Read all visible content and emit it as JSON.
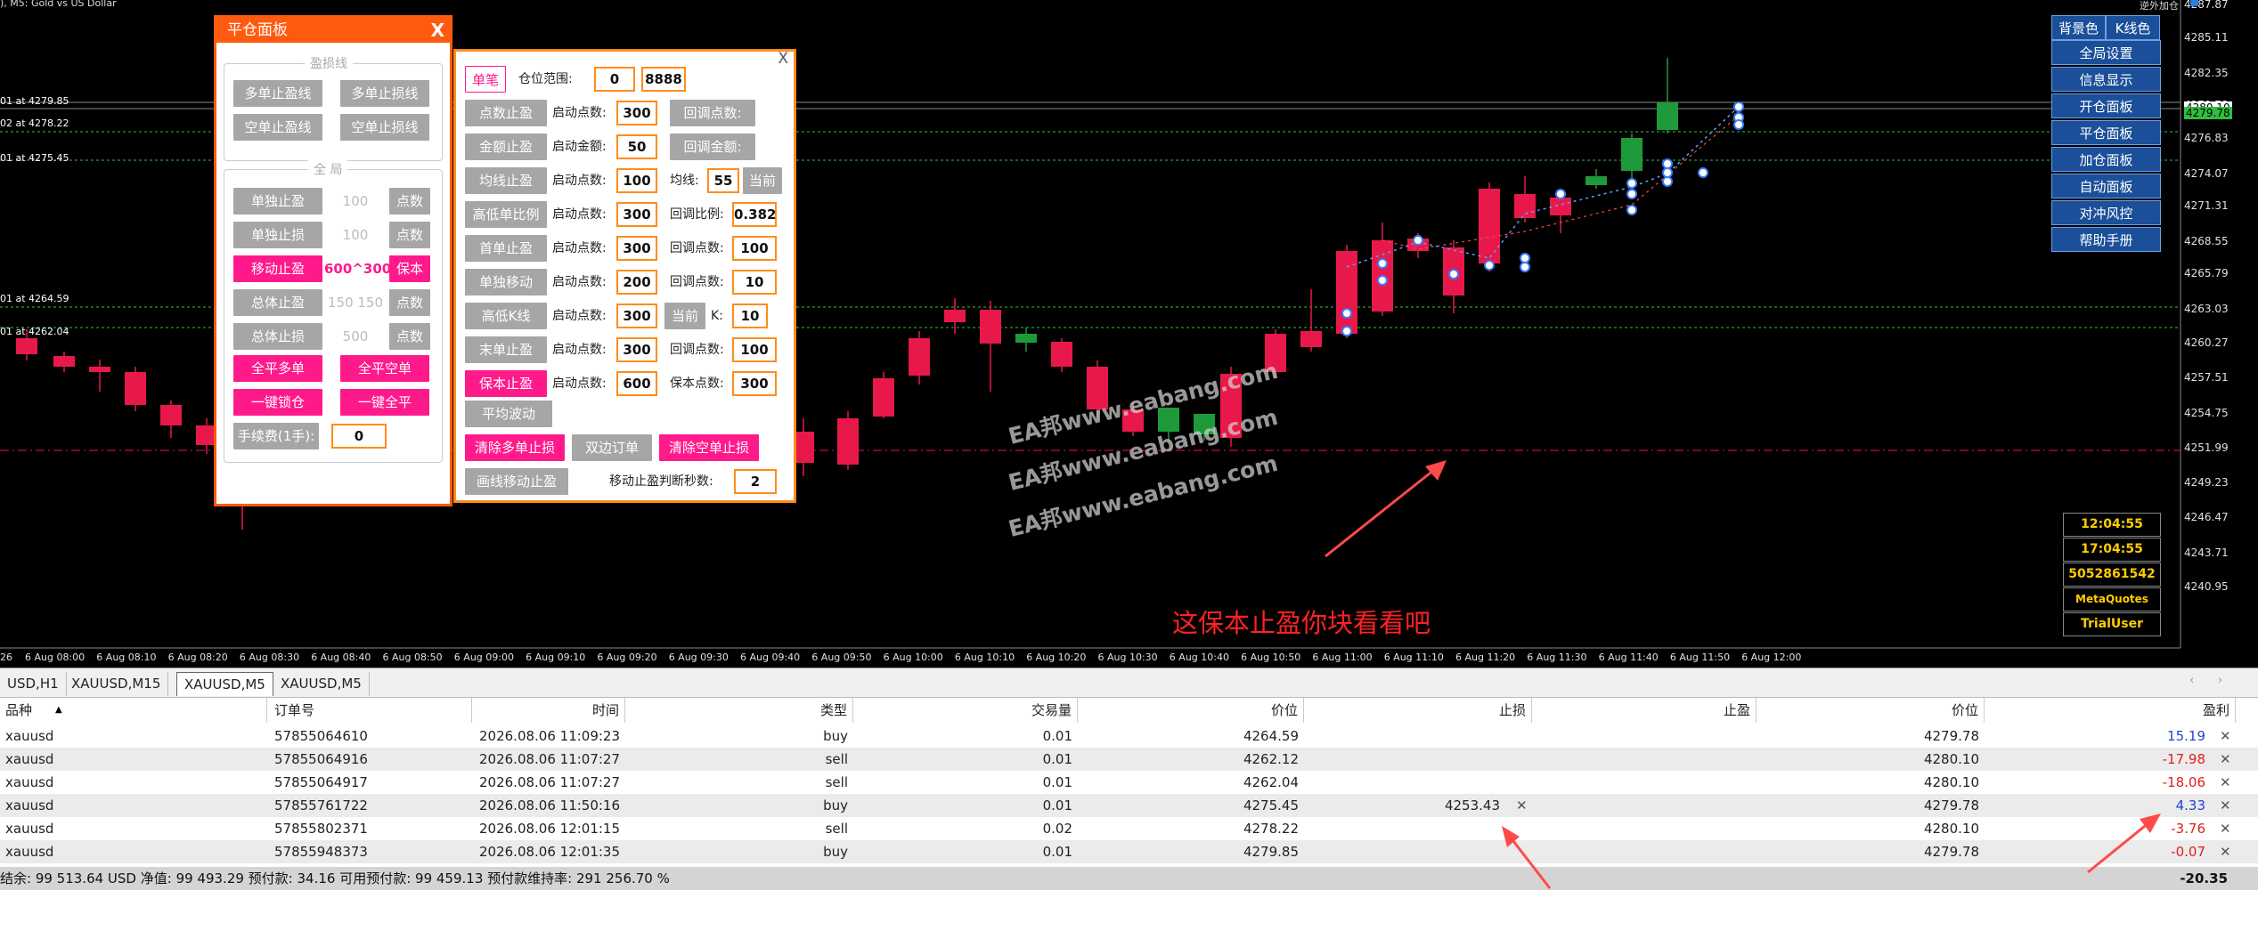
{
  "chart": {
    "symbol_title": "), M5: Gold vs US Dollar",
    "top_right_text": "逆外加仓",
    "price_labels": [
      "4287.87",
      "4285.11",
      "4282.35",
      "4279.78",
      "4276.83",
      "4274.07",
      "4271.31",
      "4268.55",
      "4265.79",
      "4263.03",
      "4260.27",
      "4257.51",
      "4254.75",
      "4251.99",
      "4249.23",
      "4246.47",
      "4243.71",
      "4240.95"
    ],
    "price_highlight": [
      "4280.10",
      "4279.78"
    ],
    "level_labels": [
      {
        "text": "01 at 4279.85",
        "color": "#ffffff"
      },
      {
        "text": "02 at 4278.22",
        "color": "#ffffff"
      },
      {
        "text": "01 at 4275.45",
        "color": "#ffffff"
      },
      {
        "text": "01 at 4264.59",
        "color": "#ffffff"
      },
      {
        "text": "01 at 4262.04",
        "color": "#ffffff"
      }
    ],
    "time_labels": [
      "26",
      "6 Aug 08:00",
      "6 Aug 08:10",
      "6 Aug 08:20",
      "6 Aug 08:30",
      "6 Aug 08:40",
      "6 Aug 08:50",
      "6 Aug 09:00",
      "6 Aug 09:10",
      "6 Aug 09:20",
      "6 Aug 09:30",
      "6 Aug 09:40",
      "6 Aug 09:50",
      "6 Aug 10:00",
      "6 Aug 10:10",
      "6 Aug 10:20",
      "6 Aug 10:30",
      "6 Aug 10:40",
      "6 Aug 10:50",
      "6 Aug 11:00",
      "6 Aug 11:10",
      "6 Aug 11:20",
      "6 Aug 11:30",
      "6 Aug 11:40",
      "6 Aug 11:50",
      "6 Aug 12:00"
    ],
    "watermark": "EA邦www.eabang.com",
    "note": "这保本止盈你块看看吧",
    "colors": {
      "bull": "#1f9a3a",
      "bear": "#e8194a",
      "grid_level": "#2fbf3f",
      "stop_line": "#e8194a"
    }
  },
  "panel1": {
    "title": "平仓面板",
    "close": "X",
    "group1_title": "盈损线",
    "group1_buttons": [
      "多单止盈线",
      "多单止损线",
      "空单止盈线",
      "空单止损线"
    ],
    "group2_title": "全 局",
    "rows": [
      {
        "button": "单独止盈",
        "value": "100",
        "unit": "点数",
        "pink": false
      },
      {
        "button": "单独止损",
        "value": "100",
        "unit": "点数",
        "pink": false
      },
      {
        "button": "移动止盈",
        "value": "600^300",
        "unit": "保本",
        "pink": true
      },
      {
        "button": "总体止盈",
        "value": "150 150",
        "unit": "点数",
        "pink": false
      },
      {
        "button": "总体止损",
        "value": "500",
        "unit": "点数",
        "pink": false
      }
    ],
    "action_buttons": [
      "全平多单",
      "全平空单",
      "一键锁仓",
      "一键全平"
    ],
    "fee_button": "手续费(1手):",
    "fee_value": "0"
  },
  "panel2": {
    "close": "X",
    "single_button": "单笔",
    "range_label": "仓位范围:",
    "range_from": "0",
    "range_to": "8888",
    "rows": [
      {
        "button": "点数止盈",
        "lbl": "启动点数:",
        "val": "300",
        "b2": "回调点数:",
        "v2": "",
        "pink": false
      },
      {
        "button": "金额止盈",
        "lbl": "启动金额:",
        "val": "50",
        "b2": "回调金额:",
        "v2": "",
        "pink": false
      },
      {
        "button": "均线止盈",
        "lbl": "启动点数:",
        "val": "100",
        "l2": "均线:",
        "v2": "55",
        "b3": "当前",
        "pink": false
      },
      {
        "button": "高低单比例",
        "lbl": "启动点数:",
        "val": "300",
        "l2": "回调比例:",
        "v2": "0.382",
        "pink": false
      },
      {
        "button": "首单止盈",
        "lbl": "启动点数:",
        "val": "300",
        "l2": "回调点数:",
        "v2": "100",
        "pink": false
      },
      {
        "button": "单独移动",
        "lbl": "启动点数:",
        "val": "200",
        "l2": "回调点数:",
        "v2": "10",
        "pink": false
      },
      {
        "button": "高低K线",
        "lbl": "启动点数:",
        "val": "300",
        "b2": "当前",
        "l2": "K:",
        "v2": "10",
        "pink": false
      },
      {
        "button": "末单止盈",
        "lbl": "启动点数:",
        "val": "300",
        "l2": "回调点数:",
        "v2": "100",
        "pink": false
      },
      {
        "button": "保本止盈",
        "lbl": "启动点数:",
        "val": "600",
        "l2": "保本点数:",
        "v2": "300",
        "pink": true
      }
    ],
    "avg_button": "平均波动",
    "clear_multi": "清除多单止损",
    "both_order": "双边订单",
    "clear_short": "清除空单止损",
    "draw_line": "画线移动止盈",
    "judge_label": "移动止盈判断秒数:",
    "judge_value": "2"
  },
  "right_menu": {
    "bg_color": "背景色",
    "k_color": "K线色",
    "items": [
      "全局设置",
      "信息显示",
      "开仓面板",
      "平仓面板",
      "加仓面板",
      "自动面板",
      "对冲风控",
      "帮助手册"
    ]
  },
  "info": [
    "12:04:55",
    "17:04:55",
    "5052861542",
    "MetaQuotes Ltd.",
    "TrialUser"
  ],
  "tabs": [
    "USD,H1",
    "XAUUSD,M15",
    "XAUUSD,M5",
    "XAUUSD,M5"
  ],
  "table": {
    "headers": [
      "品种",
      "订单号",
      "时间",
      "类型",
      "交易量",
      "价位",
      "止损",
      "止盈",
      "价位",
      "盈利"
    ],
    "rows": [
      {
        "symbol": "xauusd",
        "order": "57855064610",
        "time": "2026.08.06 11:09:23",
        "type": "buy",
        "volume": "0.01",
        "open": "4264.59",
        "sl": "",
        "tp": "",
        "price": "4279.78",
        "profit": "15.19",
        "pcolor": "#2244cc"
      },
      {
        "symbol": "xauusd",
        "order": "57855064916",
        "time": "2026.08.06 11:07:27",
        "type": "sell",
        "volume": "0.01",
        "open": "4262.12",
        "sl": "",
        "tp": "",
        "price": "4280.10",
        "profit": "-17.98",
        "pcolor": "#e02020"
      },
      {
        "symbol": "xauusd",
        "order": "57855064917",
        "time": "2026.08.06 11:07:27",
        "type": "sell",
        "volume": "0.01",
        "open": "4262.04",
        "sl": "",
        "tp": "",
        "price": "4280.10",
        "profit": "-18.06",
        "pcolor": "#e02020"
      },
      {
        "symbol": "xauusd",
        "order": "57855761722",
        "time": "2026.08.06 11:50:16",
        "type": "buy",
        "volume": "0.01",
        "open": "4275.45",
        "sl": "4253.43",
        "tp": "",
        "price": "4279.78",
        "profit": "4.33",
        "pcolor": "#2244cc"
      },
      {
        "symbol": "xauusd",
        "order": "57855802371",
        "time": "2026.08.06 12:01:15",
        "type": "sell",
        "volume": "0.02",
        "open": "4278.22",
        "sl": "",
        "tp": "",
        "price": "4280.10",
        "profit": "-3.76",
        "pcolor": "#e02020"
      },
      {
        "symbol": "xauusd",
        "order": "57855948373",
        "time": "2026.08.06 12:01:35",
        "type": "buy",
        "volume": "0.01",
        "open": "4279.85",
        "sl": "",
        "tp": "",
        "price": "4279.78",
        "profit": "-0.07",
        "pcolor": "#e02020"
      }
    ],
    "summary": "结余: 99 513.64 USD  净值: 99 493.29  预付款: 34.16  可用预付款: 99 459.13  预付款维持率: 291 256.70 %",
    "total": "-20.35"
  }
}
